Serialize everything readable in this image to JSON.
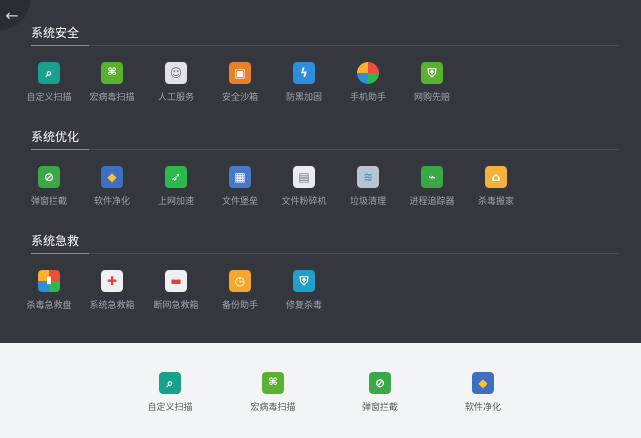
{
  "sections": [
    {
      "title": "系统安全",
      "tools": [
        {
          "label": "自定义扫描",
          "icon": "magnifier-icon"
        },
        {
          "label": "宏病毒扫描",
          "icon": "macro-virus-icon"
        },
        {
          "label": "人工服务",
          "icon": "support-person-icon"
        },
        {
          "label": "安全沙箱",
          "icon": "sandbox-icon"
        },
        {
          "label": "防黑加固",
          "icon": "shield-lightning-icon"
        },
        {
          "label": "手机助手",
          "icon": "phone-assistant-icon"
        },
        {
          "label": "网购先赔",
          "icon": "shopping-shield-icon"
        }
      ]
    },
    {
      "title": "系统优化",
      "tools": [
        {
          "label": "弹窗拦截",
          "icon": "popup-block-icon"
        },
        {
          "label": "软件净化",
          "icon": "layers-icon"
        },
        {
          "label": "上网加速",
          "icon": "rocket-icon"
        },
        {
          "label": "文件堡垒",
          "icon": "file-fortress-icon"
        },
        {
          "label": "文件粉碎机",
          "icon": "shredder-icon"
        },
        {
          "label": "垃圾清理",
          "icon": "cleanup-icon"
        },
        {
          "label": "进程追踪器",
          "icon": "pulse-icon"
        },
        {
          "label": "杀毒搬家",
          "icon": "house-icon"
        }
      ]
    },
    {
      "title": "系统急救",
      "tools": [
        {
          "label": "杀毒急救盘",
          "icon": "rescue-disk-icon"
        },
        {
          "label": "系统急救箱",
          "icon": "first-aid-box-icon"
        },
        {
          "label": "断网急救箱",
          "icon": "network-rescue-icon"
        },
        {
          "label": "备份助手",
          "icon": "backup-clock-icon"
        },
        {
          "label": "修复杀毒",
          "icon": "repair-shield-icon"
        }
      ]
    }
  ],
  "quick": [
    {
      "label": "自定义扫描",
      "icon": "magnifier-icon"
    },
    {
      "label": "宏病毒扫描",
      "icon": "macro-virus-icon"
    },
    {
      "label": "弹窗拦截",
      "icon": "popup-block-icon"
    },
    {
      "label": "软件净化",
      "icon": "layers-icon"
    }
  ],
  "back": {
    "icon": "back-arrow-icon",
    "glyph": "←"
  },
  "colors": {
    "panel": "#35373f",
    "accent": "#2fbf71",
    "bottom": "#f3f4f6"
  }
}
